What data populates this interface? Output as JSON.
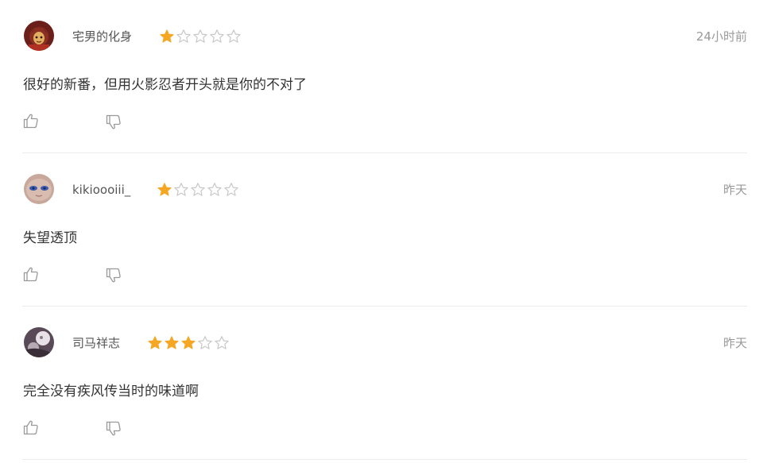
{
  "comments": [
    {
      "username": "宅男的化身",
      "rating": 1,
      "max_rating": 5,
      "time": "24小时前",
      "content": "很好的新番，但用火影忍者开头就是你的不对了",
      "avatar_colors": [
        "#6b1f1a",
        "#e0b060"
      ]
    },
    {
      "username": "kikioooiii_",
      "rating": 1,
      "max_rating": 5,
      "time": "昨天",
      "content": "失望透顶",
      "avatar_colors": [
        "#c9a89c",
        "#3a5bb0"
      ]
    },
    {
      "username": "司马祥志",
      "rating": 3,
      "max_rating": 5,
      "time": "昨天",
      "content": "完全没有疾风传当时的味道啊",
      "avatar_colors": [
        "#5a4a58",
        "#e8e2e6"
      ]
    }
  ],
  "colors": {
    "star_filled": "#f5a623",
    "star_empty_stroke": "#c8c8c8",
    "icon_stroke": "#999999",
    "divider": "#ececec"
  },
  "icons": {
    "like": "thumbs-up-icon",
    "dislike": "thumbs-down-icon",
    "star": "star-icon"
  }
}
